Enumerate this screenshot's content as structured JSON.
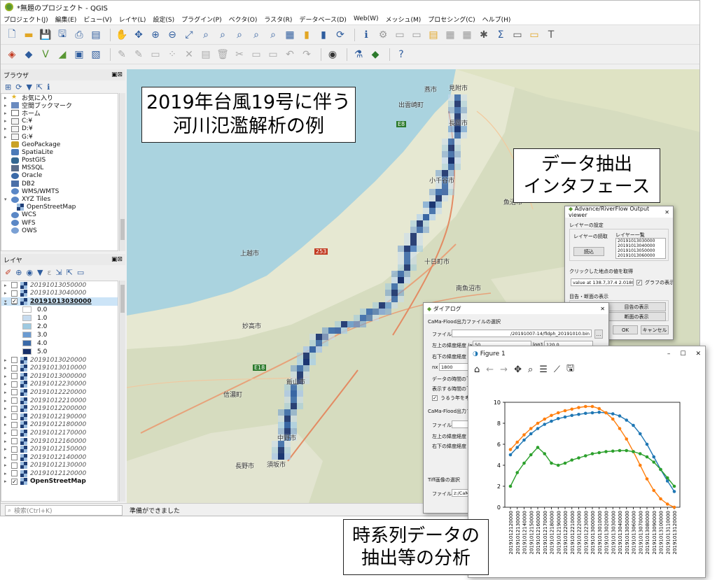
{
  "window": {
    "title": "*無題のプロジェクト - QGIS"
  },
  "menu": [
    "プロジェクト(J)",
    "編集(E)",
    "ビュー(V)",
    "レイヤ(L)",
    "設定(S)",
    "プラグイン(P)",
    "ベクタ(O)",
    "ラスタ(R)",
    "データベース(D)",
    "Web(W)",
    "メッシュ(M)",
    "プロセシング(C)",
    "ヘルプ(H)"
  ],
  "browser": {
    "title": "ブラウザ",
    "items": [
      "お気に入り",
      "空間ブックマーク",
      "ホーム",
      "C:¥",
      "D:¥",
      "G:¥",
      "GeoPackage",
      "SpatiaLite",
      "PostGIS",
      "MSSQL",
      "Oracle",
      "DB2",
      "WMS/WMTS",
      "XYZ Tiles",
      "OpenStreetMap",
      "WCS",
      "WFS",
      "OWS"
    ]
  },
  "layers": {
    "title": "レイヤ",
    "top": [
      "20191013050000",
      "20191013040000"
    ],
    "selected": "20191013030000",
    "legend": [
      "0.0",
      "1.0",
      "2.0",
      "3.0",
      "4.0",
      "5.0"
    ],
    "legend_colors": [
      "#ffffff",
      "#c6dbef",
      "#9ecae1",
      "#6b9bd1",
      "#3b6aa8",
      "#17306b"
    ],
    "rest": [
      "20191013020000",
      "20191013010000",
      "20191013000000",
      "20191012230000",
      "20191012220000",
      "20191012210000",
      "20191012200000",
      "20191012190000",
      "20191012180000",
      "20191012170000",
      "20191012160000",
      "20191012150000",
      "20191012140000",
      "20191012130000",
      "20191012120000"
    ],
    "basemap": "OpenStreetMap"
  },
  "status": {
    "search": "検索(Ctrl+K)",
    "message": "準備ができました"
  },
  "map": {
    "places": [
      "見附市",
      "出雲崎町",
      "長岡市",
      "燕市",
      "小千谷市",
      "魚沼市",
      "上越市",
      "十日町市",
      "南魚沼市",
      "妙高市",
      "信濃町",
      "飯山市",
      "中野市",
      "長野市",
      "須坂市",
      "E8",
      "E18",
      "253"
    ]
  },
  "callouts": {
    "main": [
      "2019年台風19号に伴う",
      "河川氾濫解析の例"
    ],
    "interface": [
      "データ抽出",
      "インタフェース"
    ],
    "analysis": [
      "時系列データの",
      "抽出等の分析"
    ]
  },
  "dialog1": {
    "title": "Advance/RiverFlow Output viewer",
    "group": "レイヤーの設定",
    "label_read": "レイヤーの読取",
    "label_list": "レイヤー一覧",
    "btn_read": "読込",
    "list": [
      "20191013030000",
      "20191013040000",
      "20191013050000",
      "20191013060000"
    ],
    "label_click": "クリックした地点の値を取得",
    "value": "value at 138.7,37.4 2.018017",
    "check_graph": "グラフの表示",
    "label_ts": "目告・断面の表示",
    "btn1": "目告の表示",
    "btn2": "断面の表示",
    "ok": "OK",
    "cancel": "キャンセル"
  },
  "dialog2": {
    "title": "ダイアログ",
    "group": "CaMa-Flood出力ファイルの選択",
    "file_label": "ファイル",
    "file_value": "/20191007-14/fldph_20191010.bin",
    "ul_label": "左上の緯度経度 lat1",
    "ul_lat": "50",
    "lon_label": "lon1",
    "ul_lon": "120.0",
    "lr_label": "右下の緯度経度 lat2",
    "nx_label": "nx",
    "nx_value": "1800",
    "time_label": "データの時間の下限",
    "disp_label": "表示する時間の下限",
    "check_leap": "うるう年を考慮する",
    "group2": "CaMa-Flood出力ファイル",
    "file2_label": "ファイル",
    "ul2_label": "左上の緯度経度 lat1",
    "lr2_label": "右下の緯度経度 lat2",
    "tiff_group": "Tiff画像の選択",
    "tiff_label": "ファイル",
    "tiff_value": "z:/CaMa_Floo"
  },
  "figure": {
    "title": "Figure 1"
  },
  "chart_data": {
    "type": "line",
    "ylim": [
      0,
      10
    ],
    "yticks": [
      0,
      2,
      4,
      6,
      8,
      10
    ],
    "x": [
      "20191012120000",
      "20191012130000",
      "20191012140000",
      "20191012150000",
      "20191012160000",
      "20191012170000",
      "20191012180000",
      "20191012190000",
      "20191012200000",
      "20191012210000",
      "20191012220000",
      "20191012230000",
      "20191013000000",
      "20191013010000",
      "20191013020000",
      "20191013030000",
      "20191013040000",
      "20191013050000",
      "20191013060000",
      "20191013070000",
      "20191013080000",
      "20191013090000",
      "20191013100000",
      "20191013110000",
      "20191013120000"
    ],
    "series": [
      {
        "color": "#1f77b4",
        "values": [
          5.0,
          5.7,
          6.4,
          7.0,
          7.5,
          7.9,
          8.2,
          8.45,
          8.6,
          8.75,
          8.85,
          8.95,
          9.0,
          9.05,
          9.0,
          8.9,
          8.7,
          8.3,
          7.8,
          7.0,
          6.0,
          4.8,
          3.6,
          2.5,
          1.5
        ]
      },
      {
        "color": "#ff7f0e",
        "values": [
          5.5,
          6.2,
          6.9,
          7.5,
          8.0,
          8.4,
          8.75,
          9.0,
          9.2,
          9.35,
          9.5,
          9.6,
          9.6,
          9.4,
          9.0,
          8.4,
          7.5,
          6.5,
          5.3,
          4.0,
          2.7,
          1.6,
          0.8,
          0.3,
          0.0
        ]
      },
      {
        "color": "#2ca02c",
        "values": [
          2.0,
          3.3,
          4.2,
          5.0,
          5.7,
          5.1,
          4.2,
          4.0,
          4.2,
          4.5,
          4.7,
          4.9,
          5.1,
          5.2,
          5.3,
          5.35,
          5.4,
          5.4,
          5.3,
          5.1,
          4.8,
          4.3,
          3.6,
          2.8,
          2.0
        ]
      }
    ]
  }
}
